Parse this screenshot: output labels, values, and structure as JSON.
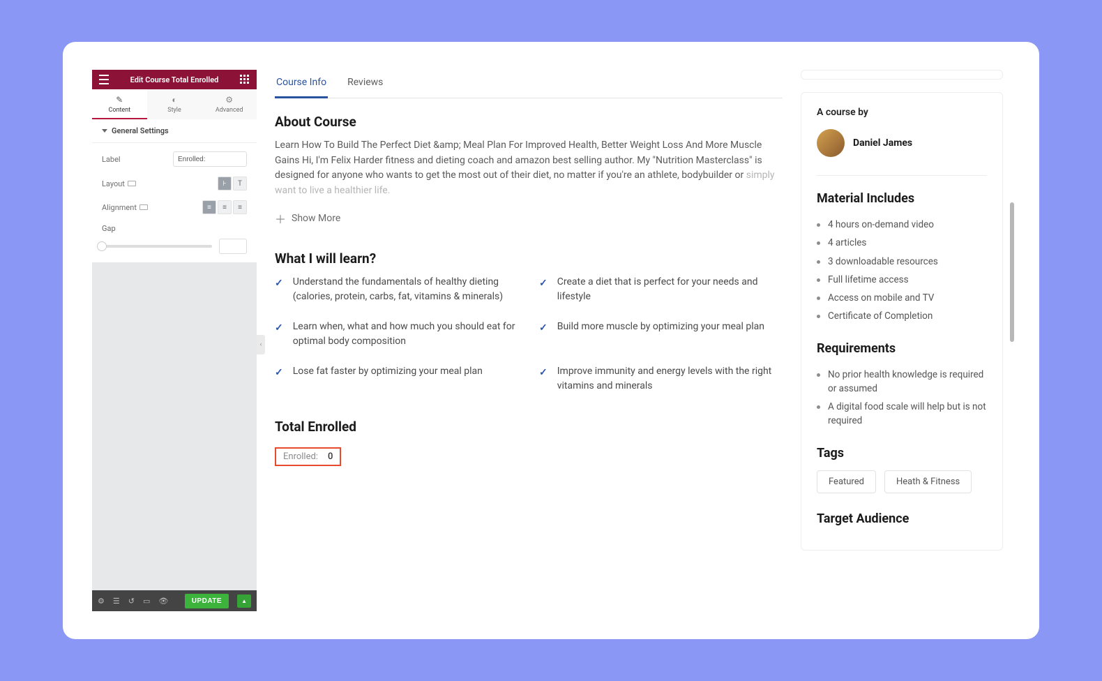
{
  "sidebar": {
    "title": "Edit Course Total Enrolled",
    "tabs": {
      "content": "Content",
      "style": "Style",
      "advanced": "Advanced"
    },
    "section_title": "General Settings",
    "label_field": "Label",
    "label_value": "Enrolled:",
    "layout_field": "Layout",
    "alignment_field": "Alignment",
    "gap_field": "Gap",
    "update_label": "UPDATE"
  },
  "tabs": {
    "course_info": "Course Info",
    "reviews": "Reviews"
  },
  "about": {
    "heading": "About Course",
    "body_visible": "Learn How To Build The Perfect Diet &amp; Meal Plan For Improved Health, Better Weight Loss And More Muscle Gains Hi, I'm Felix Harder fitness and dieting coach and amazon best selling author. My \"Nutrition Masterclass\" is designed for anyone who wants to get the most out of their diet, no matter if you're an athlete, bodybuilder or",
    "body_faded": "simply want to live a healthier life.",
    "show_more": "Show More"
  },
  "learn": {
    "heading": "What I will learn?",
    "items": [
      "Understand the fundamentals of healthy dieting (calories, protein, carbs, fat, vitamins & minerals)",
      "Create a diet that is perfect for your needs and lifestyle",
      "Learn when, what and how much you should eat for optimal body composition",
      "Build more muscle by optimizing your meal plan",
      "Lose fat faster by optimizing your meal plan",
      "Improve immunity and energy levels with the right vitamins and minerals"
    ]
  },
  "enrolled": {
    "heading": "Total Enrolled",
    "label": "Enrolled:",
    "value": "0"
  },
  "right": {
    "course_by": "A course by",
    "author": "Daniel James",
    "material_heading": "Material Includes",
    "materials": [
      "4 hours on-demand video",
      "4 articles",
      "3 downloadable resources",
      "Full lifetime access",
      "Access on mobile and TV",
      "Certificate of Completion"
    ],
    "requirements_heading": "Requirements",
    "requirements": [
      "No prior health knowledge is required or assumed",
      "A digital food scale will help but is not required"
    ],
    "tags_heading": "Tags",
    "tags": [
      "Featured",
      "Heath & Fitness"
    ],
    "audience_heading": "Target Audience"
  }
}
